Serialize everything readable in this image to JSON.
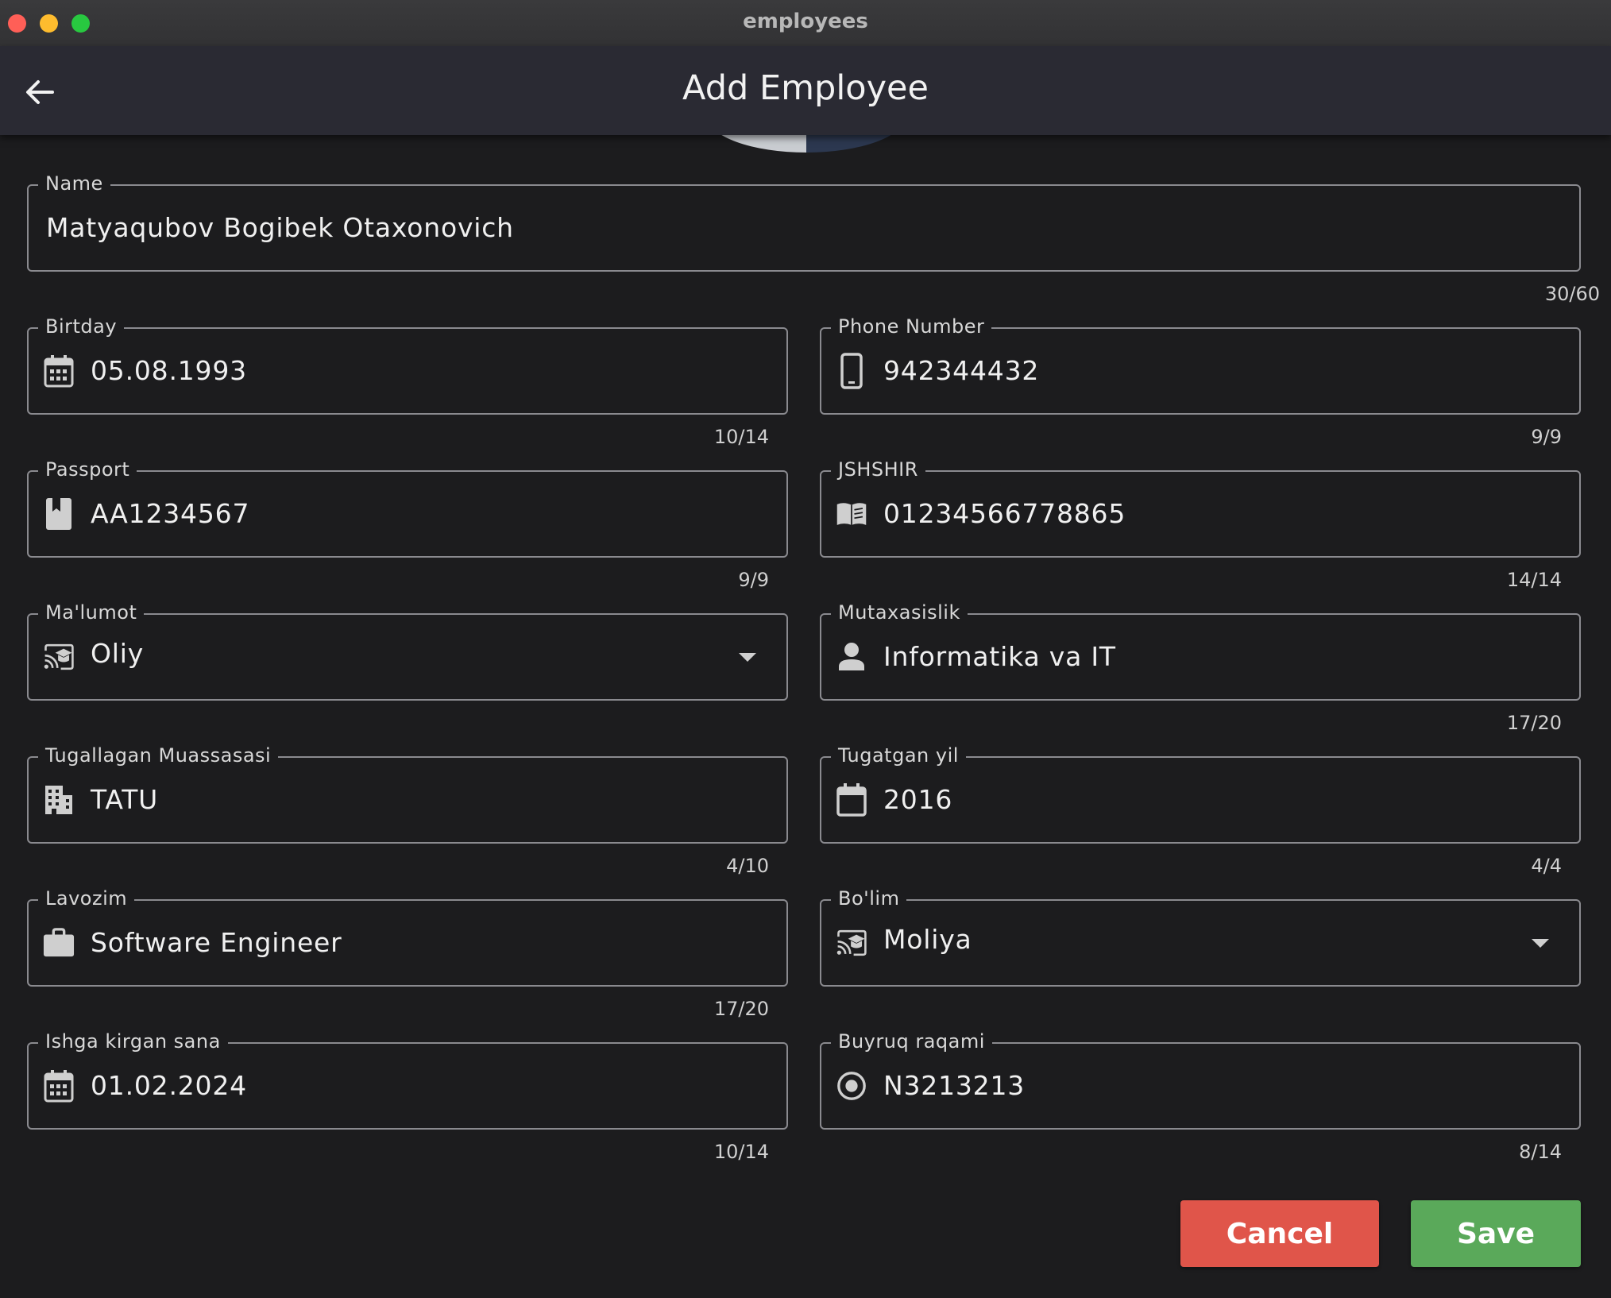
{
  "window": {
    "title": "employees"
  },
  "header": {
    "title": "Add Employee",
    "back_icon": "arrow-left-icon"
  },
  "fields": {
    "name": {
      "label": "Name",
      "value": "Matyaqubov Bogibek Otaxonovich",
      "counter": "30/60"
    },
    "birthday": {
      "label": "Birtday",
      "value": "05.08.1993",
      "counter": "10/14",
      "icon": "calendar-icon"
    },
    "phone": {
      "label": "Phone Number",
      "value": "942344432",
      "counter": "9/9",
      "icon": "smartphone-icon"
    },
    "passport": {
      "label": "Passport",
      "value": "AA1234567",
      "counter": "9/9",
      "icon": "passport-book-icon"
    },
    "jshshir": {
      "label": "JSHSHIR",
      "value": "01234566778865",
      "counter": "14/14",
      "icon": "open-book-icon"
    },
    "education": {
      "label": "Ma'lumot",
      "value": "Oliy",
      "icon": "cast-for-education-icon"
    },
    "specialty": {
      "label": "Mutaxasislik",
      "value": "Informatika va IT",
      "counter": "17/20",
      "icon": "person-icon"
    },
    "institution": {
      "label": "Tugallagan Muassasasi",
      "value": "TATU",
      "counter": "4/10",
      "icon": "building-icon"
    },
    "graduation_year": {
      "label": "Tugatgan yil",
      "value": "2016",
      "counter": "4/4",
      "icon": "calendar-outline-icon"
    },
    "position": {
      "label": "Lavozim",
      "value": "Software Engineer",
      "counter": "17/20",
      "icon": "briefcase-icon"
    },
    "department": {
      "label": "Bo'lim",
      "value": "Moliya",
      "icon": "cast-for-education-icon"
    },
    "hire_date": {
      "label": "Ishga kirgan sana",
      "value": "01.02.2024",
      "counter": "10/14",
      "icon": "calendar-icon"
    },
    "order_number": {
      "label": "Buyruq raqami",
      "value": "N3213213",
      "counter": "8/14",
      "icon": "radio-button-icon"
    }
  },
  "actions": {
    "cancel_label": "Cancel",
    "save_label": "Save"
  },
  "colors": {
    "cancel": "#e0554a",
    "save": "#5aa95a",
    "appbar": "#2a2a33",
    "background": "#1c1c1e"
  }
}
